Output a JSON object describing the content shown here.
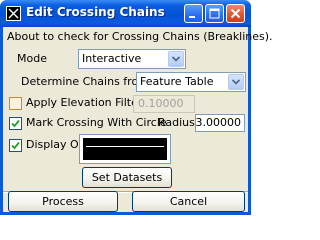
{
  "window": {
    "title": "Edit Crossing Chains"
  },
  "title_buttons": {
    "minimize_icon": "minimize-icon",
    "maximize_icon": "maximize-icon",
    "close_icon": "close-icon"
  },
  "dialog": {
    "description": "About to check for Crossing Chains (Breaklines).",
    "mode": {
      "label": "Mode",
      "value": "Interactive"
    },
    "determine_chains": {
      "label": "Determine Chains from :",
      "value": "Feature Table"
    },
    "apply_elevation_filter": {
      "label": "Apply Elevation Filter",
      "checked": false,
      "enabled": false,
      "value": "0.10000"
    },
    "mark_crossing": {
      "label": "Mark Crossing With Circle",
      "checked": true,
      "radius_label": "Radius",
      "radius_value": "3.00000"
    },
    "display_only": {
      "label": "Display Only",
      "checked": true
    }
  },
  "buttons": {
    "set_datasets": "Set Datasets",
    "process": "Process",
    "cancel": "Cancel"
  },
  "colors": {
    "titlebar": "#0453d6",
    "client": "#ece9d8",
    "close_button": "#e0532c"
  }
}
